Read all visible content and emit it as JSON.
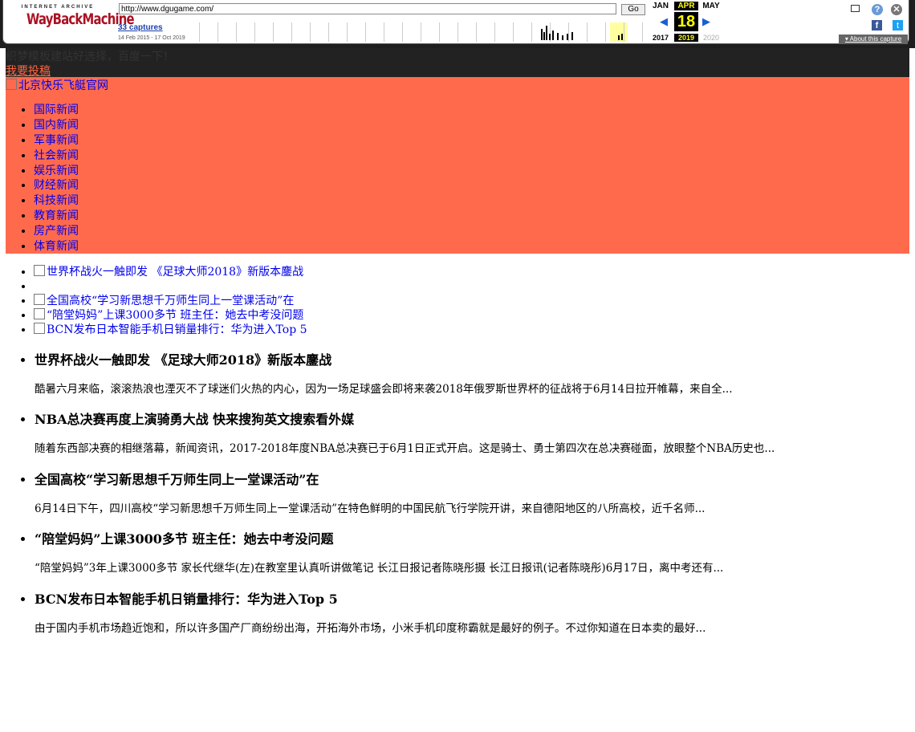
{
  "wayback": {
    "logo_top": "INTERNET ARCHIVE",
    "logo_main": "WayBackMachine",
    "url": "http://www.dgugame.com/",
    "go_label": "Go",
    "captures": "33 captures",
    "date_range": "14 Feb 2015 - 17 Oct 2019",
    "months": [
      "JAN",
      "APR",
      "MAY"
    ],
    "day": "18",
    "years": [
      "2017",
      "2019",
      "2020"
    ],
    "about": "About this capture",
    "accent": "#ffff00"
  },
  "topbar": {
    "tip": "织梦模板建站好选择，百度一下！",
    "submit_link": "我要投稿"
  },
  "header": {
    "logo_alt": "北京快乐飞艇官网",
    "bg_color": "#ff6a4d",
    "nav": [
      "国际新闻",
      "国内新闻",
      "军事新闻",
      "社会新闻",
      "娱乐新闻",
      "财经新闻",
      "科技新闻",
      "教育新闻",
      "房产新闻",
      "体育新闻"
    ]
  },
  "slides": [
    "世界杯战火一触即发 《足球大师2018》新版本鏖战",
    "",
    "全国高校“学习新思想千万师生同上一堂课活动”在",
    "“陪堂妈妈”上课3000多节 班主任：她去中考没问题",
    "BCN发布日本智能手机日销量排行：华为进入Top 5"
  ],
  "news": [
    {
      "title": "世界杯战火一触即发 《足球大师2018》新版本鏖战",
      "summary": "酷暑六月来临，滚滚热浪也湮灭不了球迷们火热的内心，因为一场足球盛会即将来袭2018年俄罗斯世界杯的征战将于6月14日拉开帷幕，来自全..."
    },
    {
      "title": "NBA总决赛再度上演骑勇大战 快来搜狗英文搜索看外媒",
      "summary": "随着东西部决赛的相继落幕，新闻资讯，2017-2018年度NBA总决赛已于6月1日正式开启。这是骑士、勇士第四次在总决赛碰面，放眼整个NBA历史也..."
    },
    {
      "title": "全国高校“学习新思想千万师生同上一堂课活动”在",
      "summary": "6月14日下午，四川高校“学习新思想千万师生同上一堂课活动”在特色鲜明的中国民航飞行学院开讲，来自德阳地区的八所高校，近千名师..."
    },
    {
      "title": "“陪堂妈妈”上课3000多节 班主任：她去中考没问题",
      "summary": "“陪堂妈妈”3年上课3000多节 家长代继华(左)在教室里认真听讲做笔记 长江日报记者陈晓彤摄 长江日报讯(记者陈晓彤)6月17日，离中考还有..."
    },
    {
      "title": "BCN发布日本智能手机日销量排行：华为进入Top 5",
      "summary": "由于国内手机市场趋近饱和，所以许多国产厂商纷纷出海，开拓海外市场，小米手机印度称霸就是最好的例子。不过你知道在日本卖的最好..."
    }
  ]
}
